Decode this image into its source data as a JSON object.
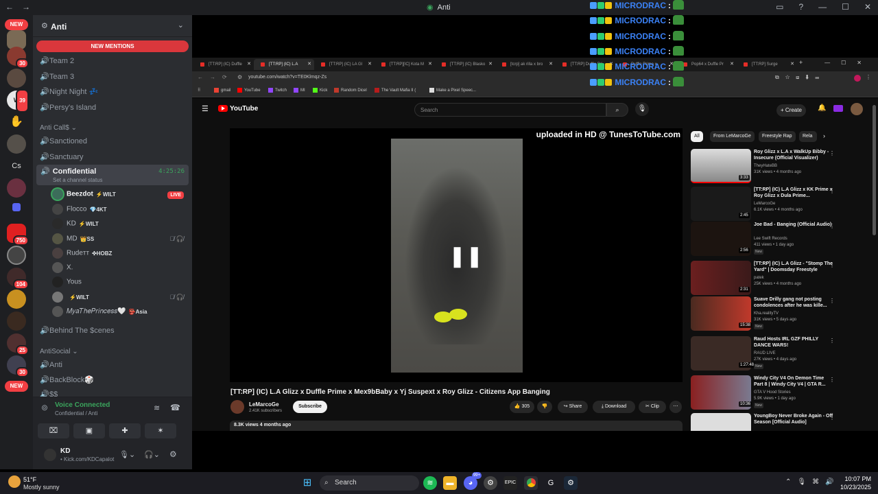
{
  "titlebar": {
    "back": "←",
    "forward": "→",
    "server_name": "Anti",
    "inbox_icon": "inbox-icon",
    "help_icon": "help-icon"
  },
  "rail": {
    "new_top": "NEW",
    "new_bottom": "NEW",
    "badges": [
      "30",
      "39",
      "750",
      "104",
      "25",
      "30"
    ],
    "cs_label": "Cs"
  },
  "sidebar": {
    "server_name": "Anti",
    "new_mentions": "NEW MENTIONS",
    "channels_top": [
      "Team 2",
      "Team 3",
      "Night Night 💤",
      "Persy's Island"
    ],
    "category_1": "Anti Call$",
    "channels_mid": [
      "Sanctioned",
      "Sanctuary"
    ],
    "active_channel": {
      "name": "Confidential",
      "status": "Set a channel status",
      "time": "4:25:26"
    },
    "voice_users": [
      {
        "name": "Beezdot",
        "tag": "⚡WILT",
        "live": "LIVE"
      },
      {
        "name": "Flocco",
        "tag": "💎4KT"
      },
      {
        "name": "KD",
        "tag": "⚡WILT"
      },
      {
        "name": "MD",
        "tag": "👑SS"
      },
      {
        "name": "Rudeтт",
        "tag": "✜HOBZ"
      },
      {
        "name": "X.",
        "tag": ""
      },
      {
        "name": "Yous",
        "tag": ""
      },
      {
        "name": "",
        "tag": "⚡WILT"
      },
      {
        "name": "𝑀𝑦𝑎𝑇ℎ𝑒𝑃𝑟𝑖𝑛𝑐𝑒𝑠𝑠🤍",
        "tag": "👺Asia"
      }
    ],
    "channel_after": "Behind The $cenes",
    "category_2": "AntiSocial",
    "channels_bottom": [
      "Anti",
      "BackBlock🎲",
      "$$"
    ],
    "voice_connected": {
      "title": "Voice Connected",
      "sub": "Confidential / Anti"
    },
    "user": {
      "name": "KD",
      "status": "• Kick.com/KDCapalot"
    }
  },
  "overlay": {
    "lines": [
      "MICRODRAC",
      "MICRODRAC",
      "MICRODRAC",
      "MICRODRAC",
      "MICRODRAC",
      "MICRODRAC"
    ],
    "colon": ":"
  },
  "browser": {
    "tabs": [
      "[TT:RP] (IC) Duffle",
      "[TT:RP] (IC) L.A",
      "[TT:RP] (IC) LA Gl",
      "[TT:RP][IC] Kota M",
      "[TT:RP] (IC) Blasko",
      "[tcrp] ak rilla x bro",
      "[TT:RP] Duffle Pri",
      "Duffle Prime x",
      "Pop64 x Duffle Pr",
      "[TT:RP] Surge"
    ],
    "url": "youtube.com/watch?v=TE0Klmqz-Zs",
    "bookmarks": [
      "gmail",
      "YouTube",
      "Twitch",
      "MI",
      "Kick",
      "Random Dicel",
      "The Vault Mafia II (",
      "Make a Pixel Speec..."
    ]
  },
  "youtube": {
    "logo": "YouTube",
    "search_placeholder": "Search",
    "create": "+ Create",
    "watermark": "uploaded in HD @ TunesToTube.com",
    "video_title": "[TT:RP] (IC) L.A Glizz x Duffle Prime x Mex9bBaby x Yj Suspext x Roy Glizz - Citizens App Banging",
    "channel": "LeMarcoGe",
    "subscribers": "2.41K subscribers",
    "subscribe": "Subscribe",
    "likes": "305",
    "share": "Share",
    "download": "Download",
    "clip": "Clip",
    "views": "8.3K views  4 months ago",
    "chips": [
      "All",
      "From LeMarcoGe",
      "Freestyle Rap",
      "Rela"
    ],
    "recs": [
      {
        "title": "Roy Glizz x L.A x WalkUp Bibby - Insecure (Official Visualizer)",
        "channel": "TheyHateBB",
        "meta": "31K views • 4 months ago",
        "dur": "3:33",
        "new": ""
      },
      {
        "title": "[TT:RP] (IC) L.A Glizz x KK Prime x Roy Glizz x Dula Prime...",
        "channel": "LeMarcoGe",
        "meta": "6.1K views • 4 months ago",
        "dur": "2:45",
        "new": ""
      },
      {
        "title": "Joe Bad - Banging (Official Audio)",
        "channel": "Lee Swift Records",
        "meta": "411 views • 1 day ago",
        "dur": "2:56",
        "new": "New"
      },
      {
        "title": "[TT:RP] (IC) L.A Glizz - \"Stomp The Yard\" | Doomsday Freestyle",
        "channel": "patek",
        "meta": "25K views • 4 months ago",
        "dur": "2:31",
        "new": ""
      },
      {
        "title": "Suave Drilly gang not posting condolences after he was kille...",
        "channel": "Kha.realityTV",
        "meta": "31K views • 5 days ago",
        "dur": "15:38",
        "new": "New"
      },
      {
        "title": "Raud Hosts IRL GZF PHILLY DANCE WARS!",
        "channel": "RAUD LIVE",
        "meta": "27K views • 4 days ago",
        "dur": "1:27:48",
        "new": "New"
      },
      {
        "title": "Windy City V4 On Demon Time Part 8 | Windy City V4 | GTA R...",
        "channel": "GTA V Hood Stories",
        "meta": "5.9K views • 1 day ago",
        "dur": "10:36",
        "new": "New"
      },
      {
        "title": "YoungBoy Never Broke Again - Off Season [Official Audio]",
        "channel": "",
        "meta": "",
        "dur": "",
        "new": ""
      }
    ]
  },
  "taskbar": {
    "weather_temp": "51°F",
    "weather_desc": "Mostly sunny",
    "search": "Search",
    "time": "10:07 PM",
    "date": "10/23/2025",
    "discord_badge": "99+"
  }
}
